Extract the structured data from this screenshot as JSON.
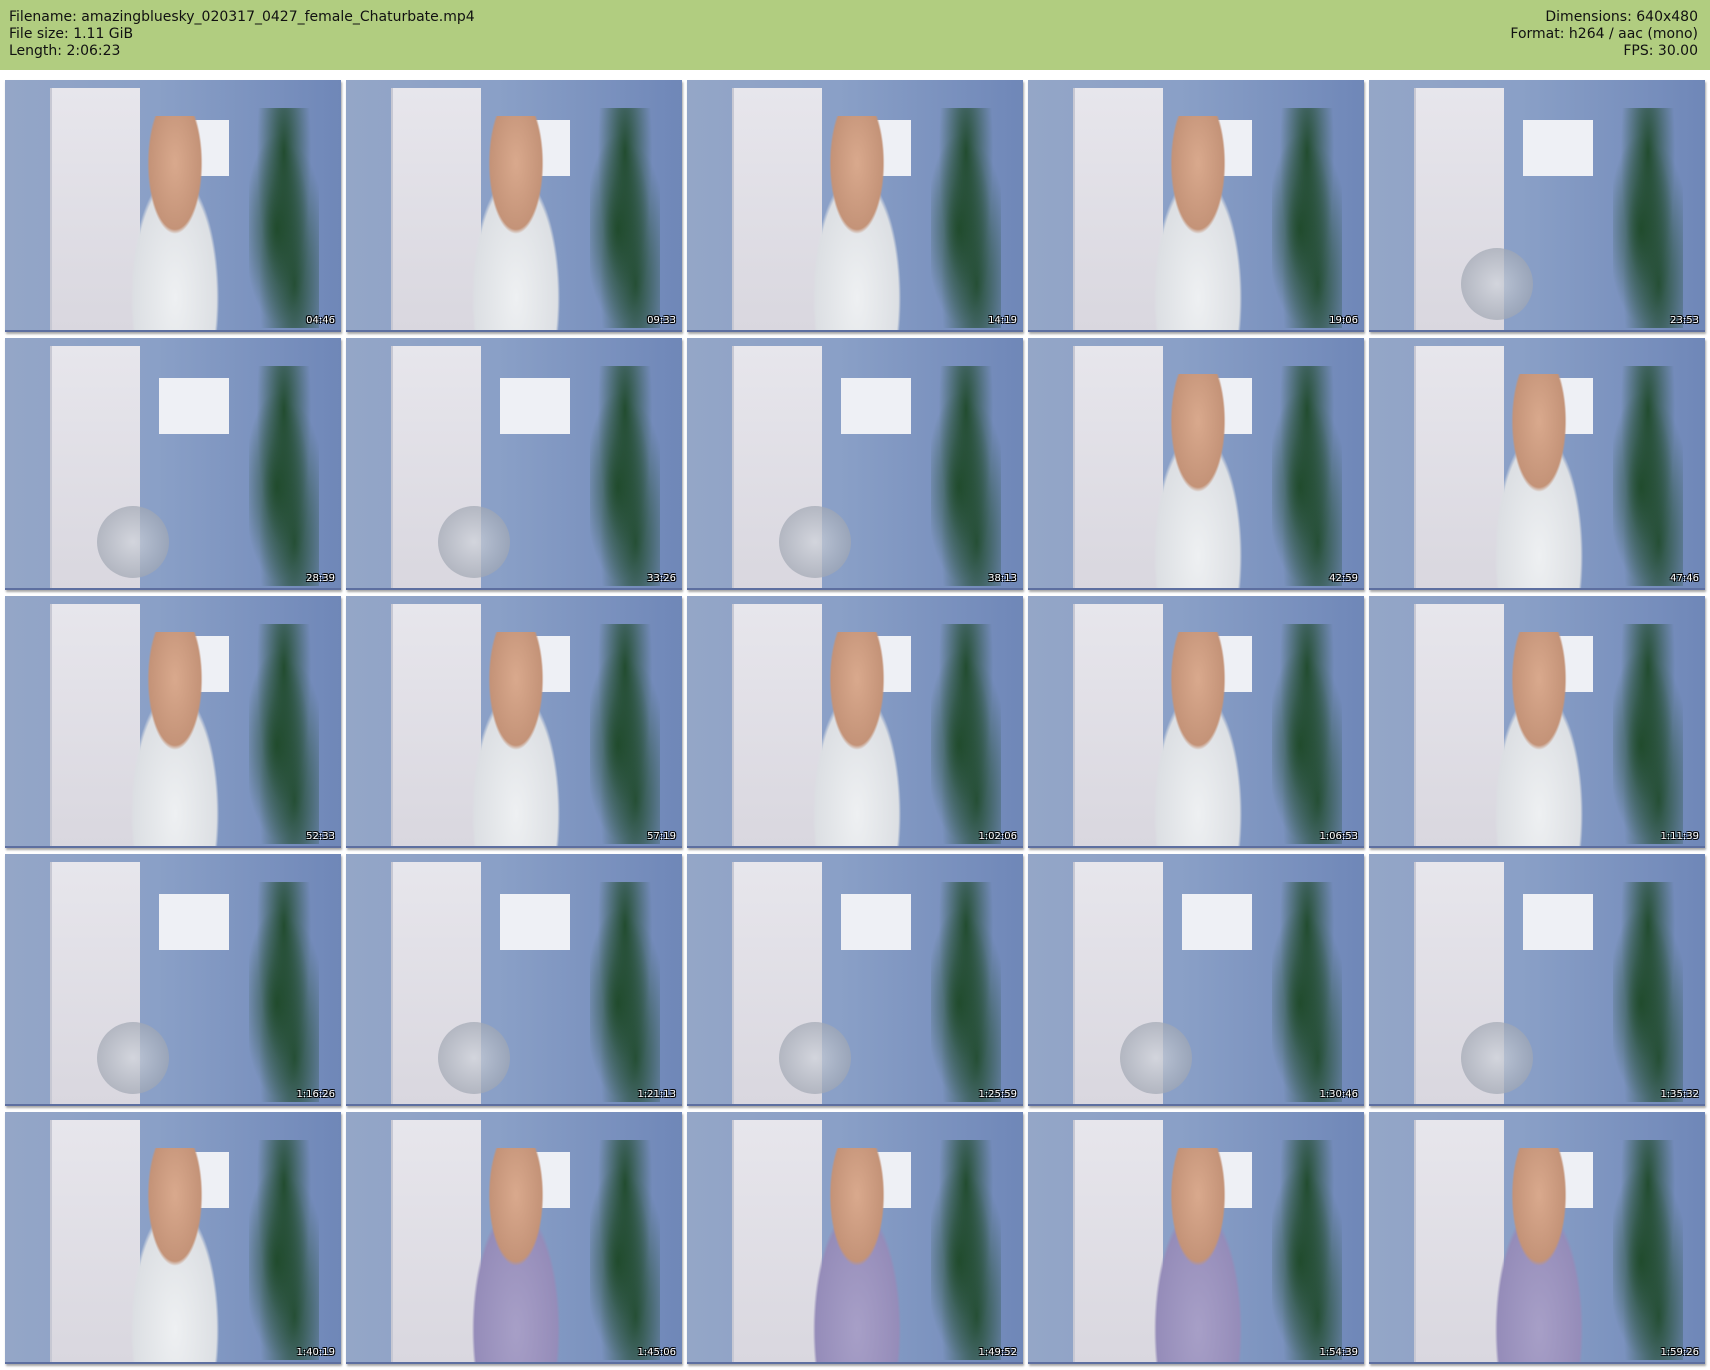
{
  "header": {
    "left": [
      "Filename: amazingbluesky_020317_0427_female_Chaturbate.mp4",
      "File size: 1.11 GiB",
      "Length: 2:06:23"
    ],
    "right": [
      "Dimensions: 640x480",
      "Format: h264 / aac (mono)",
      "FPS: 30.00"
    ]
  },
  "thumbnails": [
    {
      "time": "04:46"
    },
    {
      "time": "09:33"
    },
    {
      "time": "14:19"
    },
    {
      "time": "19:06"
    },
    {
      "time": "23:53"
    },
    {
      "time": "28:39"
    },
    {
      "time": "33:26"
    },
    {
      "time": "38:13"
    },
    {
      "time": "42:59"
    },
    {
      "time": "47:46"
    },
    {
      "time": "52:33"
    },
    {
      "time": "57:19"
    },
    {
      "time": "1:02:06"
    },
    {
      "time": "1:06:53"
    },
    {
      "time": "1:11:39"
    },
    {
      "time": "1:16:26"
    },
    {
      "time": "1:21:13"
    },
    {
      "time": "1:25:59"
    },
    {
      "time": "1:30:46"
    },
    {
      "time": "1:35:32"
    },
    {
      "time": "1:40:19"
    },
    {
      "time": "1:45:06"
    },
    {
      "time": "1:49:52"
    },
    {
      "time": "1:54:39"
    },
    {
      "time": "1:59:26"
    }
  ],
  "colors": {
    "header_bg": "#b1cd80",
    "thumb_bg": "#8aa0c7"
  }
}
